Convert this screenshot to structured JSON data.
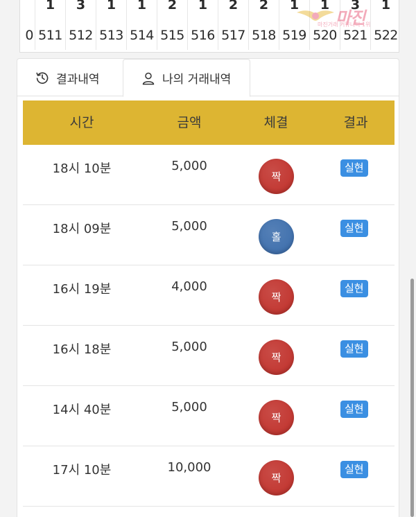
{
  "round_strip": {
    "counts": [
      "",
      "1",
      "3",
      "1",
      "1",
      "2",
      "1",
      "2",
      "2",
      "1",
      "1",
      "3",
      "1"
    ],
    "ids": [
      "0",
      "511",
      "512",
      "513",
      "514",
      "515",
      "516",
      "517",
      "518",
      "519",
      "520",
      "521",
      "522"
    ]
  },
  "watermark": {
    "title": "마진",
    "sub": "마진거래 커뮤니티 1위"
  },
  "tabs": {
    "result_label": "결과내역",
    "mine_label": "나의 거래내역"
  },
  "table": {
    "headers": {
      "time": "시간",
      "amount": "금액",
      "deal": "체결",
      "result": "결과"
    },
    "rows": [
      {
        "time": "18시 10분",
        "amount": "5,000",
        "deal": "짝",
        "deal_color": "#c0302a",
        "result": "실현"
      },
      {
        "time": "18시 09분",
        "amount": "5,000",
        "deal": "홀",
        "deal_color": "#3a6cab",
        "result": "실현"
      },
      {
        "time": "16시 19분",
        "amount": "4,000",
        "deal": "짝",
        "deal_color": "#c0302a",
        "result": "실현"
      },
      {
        "time": "16시 18분",
        "amount": "5,000",
        "deal": "짝",
        "deal_color": "#c0302a",
        "result": "실현"
      },
      {
        "time": "14시 40분",
        "amount": "5,000",
        "deal": "짝",
        "deal_color": "#c0302a",
        "result": "실현"
      },
      {
        "time": "17시 10분",
        "amount": "10,000",
        "deal": "짝",
        "deal_color": "#c0302a",
        "result": "실현"
      }
    ]
  },
  "colors": {
    "header_bg": "#ddb532",
    "badge": "#3b8fe2",
    "even": "#c0302a",
    "odd": "#3a6cab"
  },
  "icons": {
    "result_tab": "history-icon",
    "mine_tab": "user-icon"
  }
}
